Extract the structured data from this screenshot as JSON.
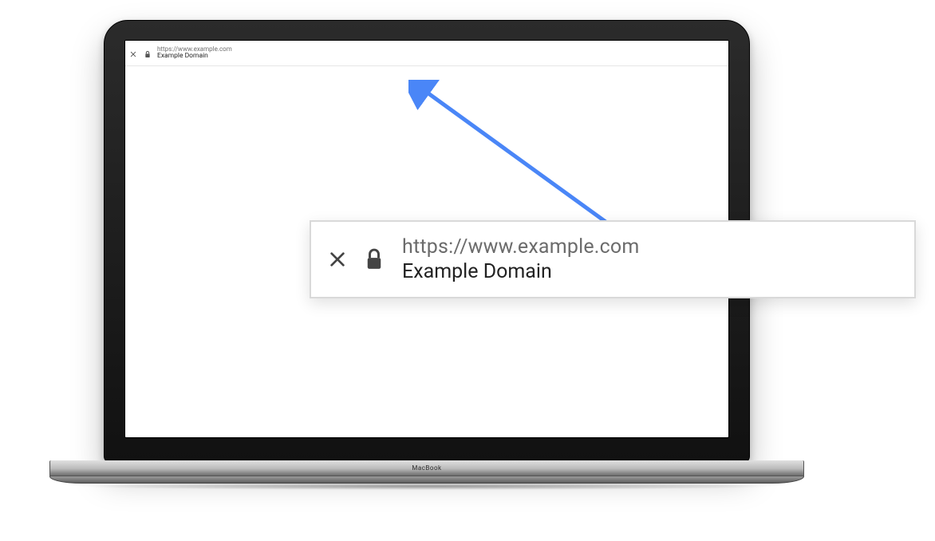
{
  "browser": {
    "url": "https://www.example.com",
    "title": "Example Domain"
  },
  "callout": {
    "url": "https://www.example.com",
    "title": "Example Domain"
  },
  "device": {
    "label": "MacBook"
  },
  "colors": {
    "arrow": "#4a86f7",
    "url_text": "#6b6b6b",
    "title_text": "#222222",
    "callout_border": "#d9d9d9"
  }
}
